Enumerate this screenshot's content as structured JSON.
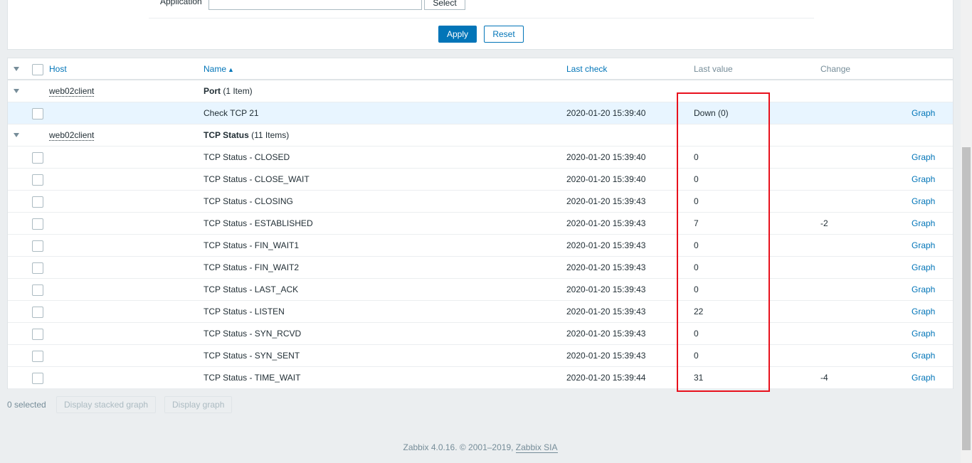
{
  "filter": {
    "application_label": "Application",
    "application_value": "",
    "select_label": "Select",
    "apply_label": "Apply",
    "reset_label": "Reset"
  },
  "table": {
    "headers": {
      "host": "Host",
      "name": "Name",
      "last_check": "Last check",
      "last_value": "Last value",
      "change": "Change"
    },
    "groups": [
      {
        "host": "web02client",
        "app_name": "Port",
        "app_count": "(1 Item)",
        "items": [
          {
            "name": "Check TCP 21",
            "last_check": "2020-01-20 15:39:40",
            "last_value": "Down (0)",
            "change": "",
            "action": "Graph"
          }
        ]
      },
      {
        "host": "web02client",
        "app_name": "TCP Status",
        "app_count": "(11 Items)",
        "items": [
          {
            "name": "TCP Status - CLOSED",
            "last_check": "2020-01-20 15:39:40",
            "last_value": "0",
            "change": "",
            "action": "Graph"
          },
          {
            "name": "TCP Status - CLOSE_WAIT",
            "last_check": "2020-01-20 15:39:40",
            "last_value": "0",
            "change": "",
            "action": "Graph"
          },
          {
            "name": "TCP Status - CLOSING",
            "last_check": "2020-01-20 15:39:43",
            "last_value": "0",
            "change": "",
            "action": "Graph"
          },
          {
            "name": "TCP Status - ESTABLISHED",
            "last_check": "2020-01-20 15:39:43",
            "last_value": "7",
            "change": "-2",
            "action": "Graph"
          },
          {
            "name": "TCP Status - FIN_WAIT1",
            "last_check": "2020-01-20 15:39:43",
            "last_value": "0",
            "change": "",
            "action": "Graph"
          },
          {
            "name": "TCP Status - FIN_WAIT2",
            "last_check": "2020-01-20 15:39:43",
            "last_value": "0",
            "change": "",
            "action": "Graph"
          },
          {
            "name": "TCP Status - LAST_ACK",
            "last_check": "2020-01-20 15:39:43",
            "last_value": "0",
            "change": "",
            "action": "Graph"
          },
          {
            "name": "TCP Status - LISTEN",
            "last_check": "2020-01-20 15:39:43",
            "last_value": "22",
            "change": "",
            "action": "Graph"
          },
          {
            "name": "TCP Status - SYN_RCVD",
            "last_check": "2020-01-20 15:39:43",
            "last_value": "0",
            "change": "",
            "action": "Graph"
          },
          {
            "name": "TCP Status - SYN_SENT",
            "last_check": "2020-01-20 15:39:43",
            "last_value": "0",
            "change": "",
            "action": "Graph"
          },
          {
            "name": "TCP Status - TIME_WAIT",
            "last_check": "2020-01-20 15:39:44",
            "last_value": "31",
            "change": "-4",
            "action": "Graph"
          }
        ]
      }
    ]
  },
  "footer": {
    "selected_count": "0 selected",
    "stacked_graph_label": "Display stacked graph",
    "graph_label": "Display graph",
    "copyright_text": "Zabbix 4.0.16. © 2001–2019, ",
    "copyright_link": "Zabbix SIA"
  },
  "colors": {
    "accent": "#0275b8",
    "annotation": "#e8111d",
    "highlight_row": "#e8f5ff"
  },
  "icons": {
    "collapse": "triangle-down-icon",
    "sort": "sort-ascending-icon"
  }
}
